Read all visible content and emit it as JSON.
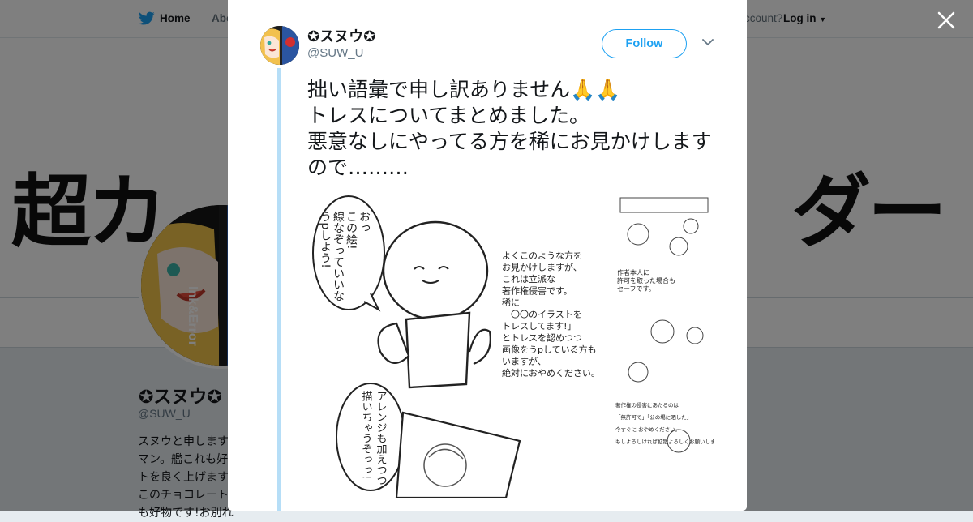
{
  "nav": {
    "home_label": "Home",
    "about_label": "Abo",
    "have_account": "ccount?",
    "login_label": "Log in"
  },
  "banner": {
    "left_text": "超カ",
    "right_text": "ダー"
  },
  "avatar_overlay_text": "Ink&Error",
  "background_profile": {
    "name": "✪スヌウ✪",
    "handle": "@SUW_U",
    "bio_lines": [
      "スヌウと申します",
      "マン。艦これも好",
      "トを良く上げます",
      "このチョコレート",
      "も好物です!お別れ"
    ]
  },
  "tweet": {
    "author_name": "✪スヌウ✪",
    "author_handle": "@SUW_U",
    "follow_label": "Follow",
    "text": "拙い語彙で申し訳ありません🙏🙏\nトレスについてまとめました。\n悪意なしにやってる方を稀にお見かけしますので………"
  },
  "media": {
    "speech_bubble_1": [
      "おっ",
      "この絵!",
      "線なぞっていいな",
      "うpしよう!"
    ],
    "speech_bubble_2": [
      "アレンジも加えつつ",
      "描いちゃうぞっっ!"
    ],
    "narration": [
      "よくこのような方を",
      "お見かけしますが、",
      "これは立派な",
      "著作権侵害です。",
      "稀に",
      "「〇〇のイラストを",
      "トレスしてます!」",
      "とトレスを認めつつ",
      "画像をうpしている方も",
      "いますが、",
      "絶対におやめください。"
    ],
    "side_panel_1": [
      "作者本人に",
      "許可を取った場合も",
      "セーフです。"
    ],
    "side_panel_2": [
      "著作権の侵害にあたるのは",
      "「無許可で」「公の場に晒した」",
      "今すぐに おやめください。",
      "もしよろしければ拡散よろしくお願いします。"
    ]
  },
  "colors": {
    "accent": "#1da1f2",
    "thread_line": "#b6def7",
    "text_primary": "#14171a",
    "text_secondary": "#657786"
  }
}
